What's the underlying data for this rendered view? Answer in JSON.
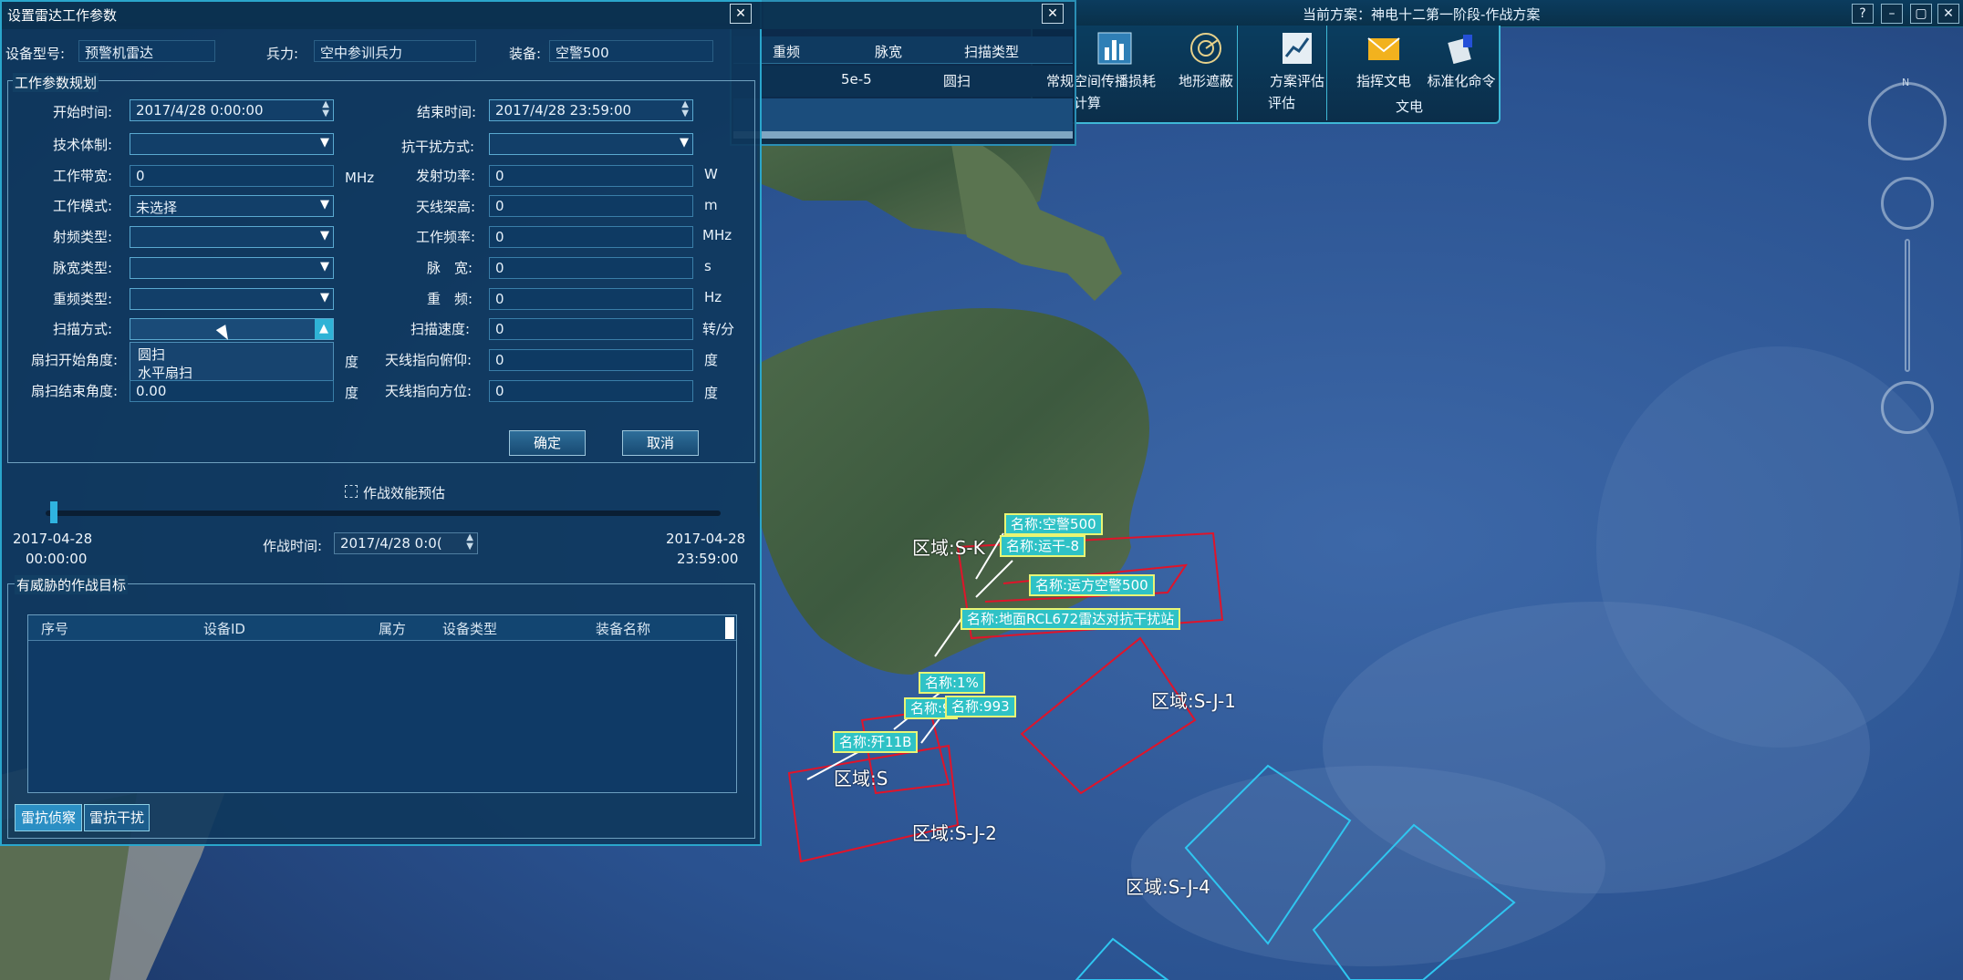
{
  "window": {
    "plan": "当前方案：神电十二第一阶段-作战方案",
    "buttons": [
      "?",
      "–",
      "▢",
      "✕"
    ]
  },
  "toolbar": {
    "items": [
      {
        "label": "空间传播损耗",
        "icon": "chart-icon"
      },
      {
        "label": "地形遮蔽",
        "icon": "radar-icon"
      },
      {
        "label": "方案评估",
        "icon": "trend-chart-icon"
      },
      {
        "label": "指挥文电",
        "icon": "envelope-icon"
      },
      {
        "label": "标准化命令",
        "icon": "command-icon"
      }
    ],
    "groups": [
      "计算",
      "评估",
      "文电"
    ]
  },
  "second_dialog": {
    "columns": [
      "重频",
      "脉宽",
      "扫描类型"
    ],
    "row": [
      "",
      "5e-5",
      "圆扫",
      "常规"
    ]
  },
  "dialog": {
    "title": "设置雷达工作参数",
    "device_type_label": "设备型号:",
    "device_type_value": "预警机雷达",
    "force_label": "兵力:",
    "force_value": "空中参训兵力",
    "equipment_label": "装备:",
    "equipment_value": "空警500",
    "section_title": "工作参数规划",
    "start_time_label": "开始时间:",
    "start_time_value": "2017/4/28 0:00:00",
    "end_time_label": "结束时间:",
    "end_time_value": "2017/4/28 23:59:00",
    "tech_label": "技术体制:",
    "tech_value": "",
    "anti_jam_label": "抗干扰方式:",
    "anti_jam_value": "",
    "bandwidth_label": "工作带宽:",
    "bandwidth_value": "0",
    "bandwidth_unit": "MHz",
    "power_label": "发射功率:",
    "power_value": "0",
    "power_unit": "W",
    "mode_label": "工作模式:",
    "mode_value": "未选择",
    "antenna_height_label": "天线架高:",
    "antenna_height_value": "0",
    "antenna_height_unit": "m",
    "rf_type_label": "射频类型:",
    "rf_type_value": "",
    "freq_label": "工作频率:",
    "freq_value": "0",
    "freq_unit": "MHz",
    "pulse_type_label": "脉宽类型:",
    "pulse_type_value": "",
    "pulse_width_label": "脉　宽:",
    "pulse_width_value": "0",
    "pulse_width_unit": "s",
    "prf_type_label": "重频类型:",
    "prf_type_value": "",
    "prf_label": "重　频:",
    "prf_value": "0",
    "prf_unit": "Hz",
    "scan_mode_label": "扫描方式:",
    "scan_mode_value": "",
    "scan_options": [
      "圆扫",
      "水平扇扫"
    ],
    "scan_speed_label": "扫描速度:",
    "scan_speed_value": "0",
    "scan_speed_unit": "转/分",
    "sector_start_label": "扇扫开始角度:",
    "sector_start_unit": "度",
    "elevation_label": "天线指向俯仰:",
    "elevation_value": "0",
    "elevation_unit": "度",
    "sector_end_label": "扇扫结束角度:",
    "sector_end_value": "0.00",
    "sector_end_unit": "度",
    "azimuth_label": "天线指向方位:",
    "azimuth_value": "0",
    "azimuth_unit": "度",
    "ok_label": "确定",
    "cancel_label": "取消",
    "effect_label": "作战效能预估",
    "timeline_start": "2017-04-28",
    "timeline_start_time": "00:00:00",
    "timeline_end": "2017-04-28",
    "timeline_end_time": "23:59:00",
    "battle_time_label": "作战时间:",
    "battle_time_value": "2017/4/28 0:0(",
    "timeline_progress": 0.01,
    "threat_title": "有威胁的作战目标",
    "table_columns": [
      "序号",
      "设备ID",
      "属方",
      "设备类型",
      "装备名称"
    ],
    "tab_recon": "雷抗侦察",
    "tab_jam": "雷抗干扰"
  },
  "map": {
    "tags": [
      "名称:空警500",
      "名称:运干-8",
      "名称:运方空警500",
      "名称:地面RCL672雷达对抗干扰站",
      "名称:1%",
      "名称:9",
      "名称:993",
      "名称:歼11B"
    ],
    "regions": [
      "区域:S-K",
      "区域:S-J-1",
      "区域:S",
      "区域:S-J-2",
      "区域:S-J-4"
    ]
  }
}
